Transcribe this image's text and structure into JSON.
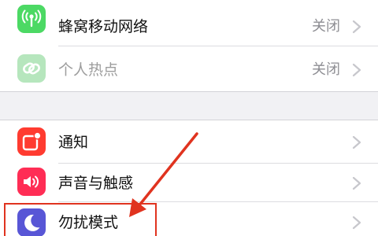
{
  "settings": {
    "cellular": {
      "label": "蜂窝移动网络",
      "value": "关闭",
      "icon": "antenna-icon",
      "icon_color": "#4cd964"
    },
    "hotspot": {
      "label": "个人热点",
      "value": "关闭",
      "icon": "link-icon",
      "icon_color": "#b6e6bd"
    },
    "notifications": {
      "label": "通知",
      "icon": "notification-icon",
      "icon_color": "#ff3b30"
    },
    "sounds": {
      "label": "声音与触感",
      "icon": "speaker-icon",
      "icon_color": "#ff2d55"
    },
    "dnd": {
      "label": "勿扰模式",
      "icon": "moon-icon",
      "icon_color": "#5856d6"
    }
  },
  "annotation": {
    "color": "#e0331f"
  }
}
